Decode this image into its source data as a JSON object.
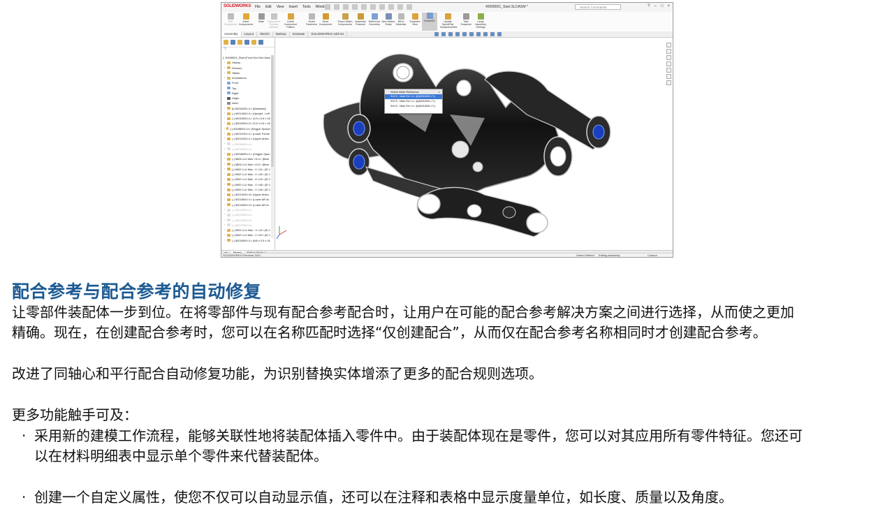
{
  "screenshot": {
    "app_logo": "SOLIDWORKS",
    "menu": [
      "File",
      "Edit",
      "View",
      "Insert",
      "Tools",
      "Window"
    ],
    "document_title": "40008001_Start.SLDASM *",
    "search_placeholder": "Search Commands",
    "ribbon": [
      {
        "label": "Edit Component",
        "disabled": true,
        "color": "#bdbdbd"
      },
      {
        "label": "Insert Components",
        "disabled": false,
        "color": "#e0a83a"
      },
      {
        "label": "Mate",
        "disabled": false,
        "color": "#9a9a9a"
      },
      {
        "label": "Component Preview Window",
        "disabled": true,
        "color": "#c6c6c6"
      },
      {
        "label": "Linear Component Pattern",
        "disabled": false,
        "color": "#d9a440"
      },
      {
        "label": "Smart Fasteners",
        "disabled": false,
        "color": "#b8b8b8"
      },
      {
        "label": "Move Component",
        "disabled": false,
        "color": "#d29a35"
      },
      {
        "label": "Show Hidden Components",
        "disabled": false,
        "color": "#c7a24a"
      },
      {
        "label": "Assembly Features",
        "disabled": false,
        "color": "#c99a3a"
      },
      {
        "label": "Reference Geometry",
        "disabled": false,
        "color": "#7ba0d1"
      },
      {
        "label": "New Motion Study",
        "disabled": false,
        "color": "#7b8fb6"
      },
      {
        "label": "Bill of Materials",
        "disabled": false,
        "color": "#b9b9b9"
      },
      {
        "label": "Exploded View",
        "disabled": false,
        "color": "#d9a440"
      },
      {
        "label": "Instant3D",
        "disabled": false,
        "selected": true,
        "color": "#7a9ad0"
      },
      {
        "label": "Update SpeedPak Subassemblies",
        "disabled": false,
        "color": "#d9a440"
      },
      {
        "label": "Take Snapshot",
        "disabled": false,
        "color": "#9a9a9a"
      },
      {
        "label": "Large Assembly Settings",
        "disabled": false,
        "color": "#8bb04a"
      }
    ],
    "tabs": [
      "Assembly",
      "Layout",
      "Sketch",
      "Markup",
      "Evaluate",
      "SOLIDWORKS Add-Ins"
    ],
    "active_tab": "Assembly",
    "tree": [
      {
        "label": "40008001_Start (Front End Sub Asse",
        "type": "root"
      },
      {
        "label": "History",
        "type": "folder"
      },
      {
        "label": "Sensors",
        "type": "folder"
      },
      {
        "label": "Tables",
        "type": "folder"
      },
      {
        "label": "Annotations",
        "type": "folder"
      },
      {
        "label": "Front",
        "type": "plane"
      },
      {
        "label": "Top",
        "type": "plane"
      },
      {
        "label": "Right",
        "type": "plane"
      },
      {
        "label": "Origin",
        "type": "origin"
      },
      {
        "label": "Axis1",
        "type": "axis"
      },
      {
        "label": "(f) 60218001<1> (Bulkhead)",
        "type": "part"
      },
      {
        "label": "(-) 60214001<1> (Upright - Left",
        "type": "part"
      },
      {
        "label": "(-) 60043001<1> (3.5 x 0.6 x 18",
        "type": "part"
      },
      {
        "label": "(-) 60043001<2> (3.5 x 0.6 x 18",
        "type": "part"
      },
      {
        "label": "(-) 60258001<2> (Kingpin Spacer",
        "type": "part"
      },
      {
        "label": "(-) 60211001<1> (Lower Forme",
        "type": "part"
      },
      {
        "label": "(-) 60210001<1> (Upper Articu",
        "type": "part"
      },
      {
        "label": "(-) 60046001<1>",
        "type": "dim"
      },
      {
        "label": "(-) 60231001<1>",
        "type": "dim"
      },
      {
        "label": "(-) 60258001<1> (Kingpin Spac",
        "type": "part"
      },
      {
        "label": "(-) 6806 LLU Max <3>1> (Bear",
        "type": "part"
      },
      {
        "label": "(-) 6806 LLU Max <2>2> (Bear",
        "type": "part"
      },
      {
        "label": "(-) 6902 LLU Max - 0 <12> (ID 1",
        "type": "part"
      },
      {
        "label": "(-) 6902 LLU Max - 0 <15> (ID 1",
        "type": "part"
      },
      {
        "label": "(-) 6902 LLU Max - 8 <13> (ID 1",
        "type": "part"
      },
      {
        "label": "(-) 6902 LLU Max - 0 <18> (ID 1",
        "type": "part"
      },
      {
        "label": "(-) 6902 LLU Max - 0 <16> (ID 1",
        "type": "part"
      },
      {
        "label": "(-) 60210001<3> (Upper Articu",
        "type": "part"
      },
      {
        "label": "(-) 60218001<1> (Lower AR Ar",
        "type": "part"
      },
      {
        "label": "(-) 60218001<3> (Lower AR Ar",
        "type": "part"
      },
      {
        "label": "(-) 60215001<1>",
        "type": "dim"
      },
      {
        "label": "(-) 60219001<1>",
        "type": "dim"
      },
      {
        "label": "(-) 60223001<3>",
        "type": "dim"
      },
      {
        "label": "(-) 60227001<4>",
        "type": "dim"
      },
      {
        "label": "(-) 6902 LLU Max - 0 <11> (ID 1",
        "type": "part"
      },
      {
        "label": "(-) 6902 LLU Max - 0 <22> (ID 1",
        "type": "part"
      },
      {
        "label": "(-) 60018001<1> (6/6 x 0.5 x 16",
        "type": "part"
      }
    ],
    "popup": {
      "title": "Select Mate Reference",
      "items": [
        "SHCS - Mate Ref <1> @(60018001<7>)",
        "SHCS - Mate Ref <1> @(60018001<7>)",
        "SHCS - Mate Ref <1> @(60018001<7>)"
      ]
    },
    "bottom_tabs": [
      "Model",
      "Motion Study 1"
    ],
    "status": {
      "left": "SOLIDWORKS Premium 2021",
      "defined": "Under Defined",
      "editing": "Editing Assembly",
      "units": "Custom"
    }
  },
  "content": {
    "title": "配合参考与配合参考的自动修复",
    "para1_line1": "让零部件装配体一步到位。在将零部件与现有配合参考配合时，让用户在可能的配合参考解决方案之间进行选择，从而使之更加",
    "para1_line2": "精确。现在，在创建配合参考时，您可以在名称匹配时选择“仅创建配合”，从而仅在配合参考名称相同时才创建配合参考。",
    "para2": "改进了同轴心和平行配合自动修复功能，为识别替换实体增添了更多的配合规则选项。",
    "para3": "更多功能触手可及：",
    "bullet1_line1": "采用新的建模工作流程，能够关联性地将装配体插入零件中。由于装配体现在是零件，您可以对其应用所有零件特征。您还可",
    "bullet1_line2": "以在材料明细表中显示单个零件来代替装配体。",
    "bullet2": "创建一个自定义属性，使您不仅可以自动显示值，还可以在注释和表格中显示度量单位，如长度、质量以及角度。",
    "bullet_mark": "·"
  }
}
